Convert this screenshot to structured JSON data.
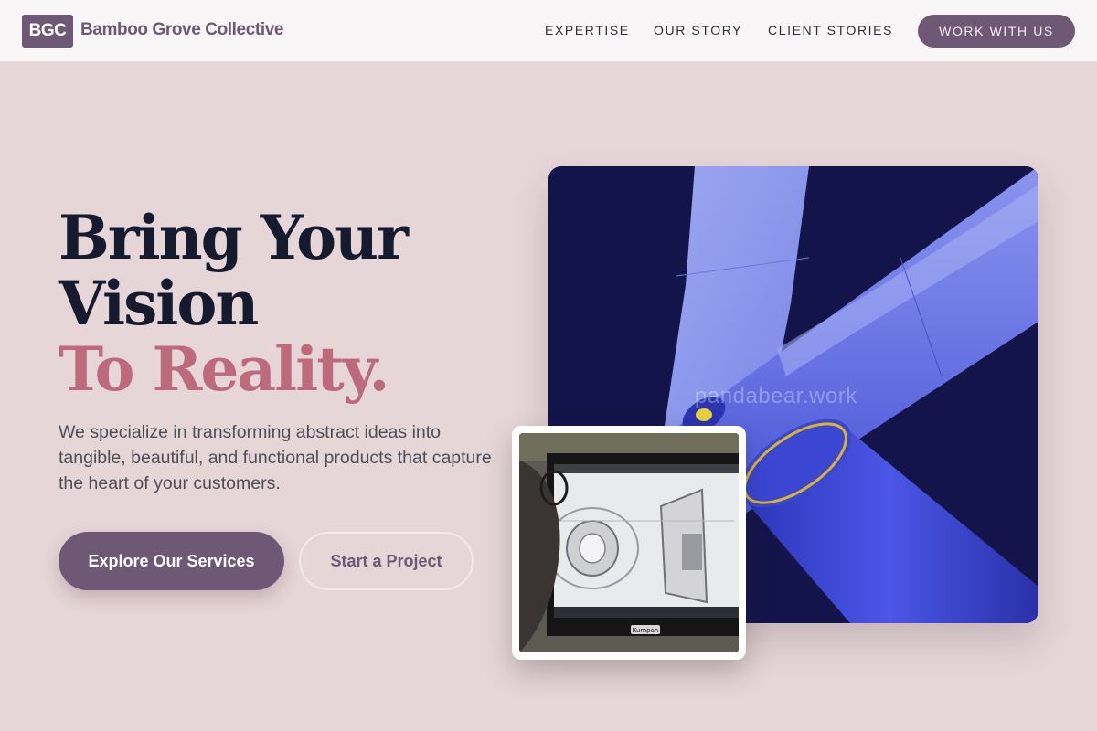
{
  "header": {
    "logo_badge": "BGC",
    "brand_name": "Bamboo Grove Collective",
    "nav": {
      "expertise": "EXPERTISE",
      "our_story": "OUR STORY",
      "client_stories": "CLIENT STORIES"
    },
    "cta_label": "WORK WITH US"
  },
  "hero": {
    "title_line1": "Bring Your",
    "title_line2": "Vision",
    "title_line3": "To Reality.",
    "description": "We specialize in transforming abstract ideas into tangible, beautiful, and functional products that capture the heart of your customers.",
    "primary_button": "Explore Our Services",
    "secondary_button": "Start a Project"
  },
  "visual": {
    "watermark": "pandabear.work",
    "monitor_brand": "Kumpan"
  },
  "colors": {
    "brand": "#6e5876",
    "accent": "#bd6a7d",
    "background": "#e6d6d7",
    "header_bg": "#f8f6f7",
    "title": "#151a2e"
  }
}
